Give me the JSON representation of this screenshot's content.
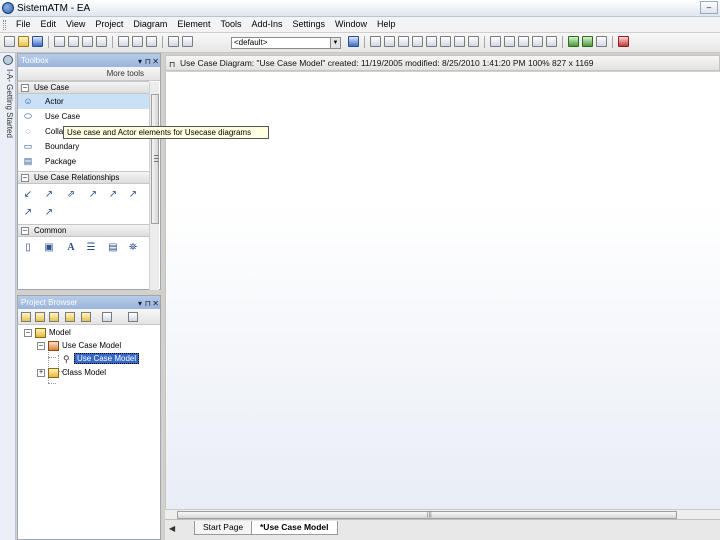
{
  "window": {
    "title": "SistemATM - EA"
  },
  "menu": [
    "File",
    "Edit",
    "View",
    "Project",
    "Diagram",
    "Element",
    "Tools",
    "Add-Ins",
    "Settings",
    "Window",
    "Help"
  ],
  "toolbar": {
    "profile_combo": "<default>"
  },
  "sidestrip": {
    "text": "I-A- Getting Started"
  },
  "toolbox": {
    "title": "Toolbox",
    "more_tools": "More tools",
    "sections": [
      {
        "name": "Use Case",
        "items": [
          "Actor",
          "Use Case",
          "Collaboration",
          "Boundary",
          "Package"
        ]
      },
      {
        "name": "Use Case Relationships"
      },
      {
        "name": "Common"
      }
    ]
  },
  "tooltip": {
    "text": "Use case and Actor elements for Usecase diagrams"
  },
  "project_browser": {
    "title": "Project Browser",
    "tree": {
      "root": "Model",
      "package": "Use Case Model",
      "diagram": "Use Case Model",
      "second_package": "Class Model"
    }
  },
  "diagram": {
    "header": "Use Case Diagram: \"Use Case Model\"  created: 11/19/2005  modified: 8/25/2010 1:41:20 PM  100%  827 x 1169"
  },
  "tabs": [
    "Start Page",
    "*Use Case Model"
  ]
}
